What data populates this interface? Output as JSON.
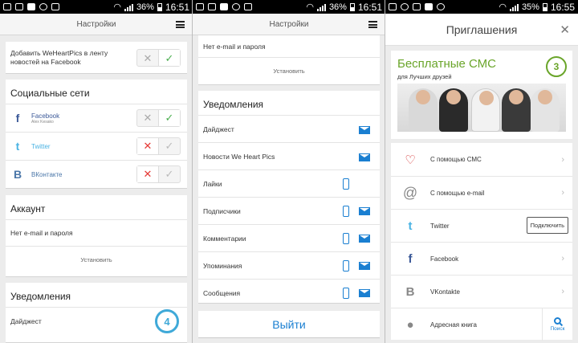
{
  "status_bar": [
    {
      "battery": "36%",
      "time": "16:51"
    },
    {
      "battery": "36%",
      "time": "16:51"
    },
    {
      "battery": "35%",
      "time": "16:55"
    }
  ],
  "screen1": {
    "title": "Настройки",
    "facebook_feed_label": "Добавить WeHeartPics в ленту новостей на Facebook",
    "social": {
      "title": "Социальные сети",
      "items": [
        {
          "name": "Facebook",
          "sub": "Alex Kesako",
          "connected": true
        },
        {
          "name": "Twitter",
          "connected": false
        },
        {
          "name": "ВКонтакте",
          "connected": false
        }
      ]
    },
    "account": {
      "title": "Аккаунт",
      "status": "Нет e-mail и пароля",
      "button": "Установить"
    },
    "notifications": {
      "title": "Уведомления",
      "first_item": "Дайджест",
      "step_badge": "4"
    }
  },
  "screen2": {
    "title": "Настройки",
    "account_status": "Нет e-mail и пароля",
    "account_button": "Установить",
    "notifications": {
      "title": "Уведомления",
      "items": [
        {
          "label": "Дайджест",
          "phone": false,
          "mail": true
        },
        {
          "label": "Новости We Heart Pics",
          "phone": false,
          "mail": true
        },
        {
          "label": "Лайки",
          "phone": true,
          "mail": false
        },
        {
          "label": "Подписчики",
          "phone": true,
          "mail": true
        },
        {
          "label": "Комментарии",
          "phone": true,
          "mail": true
        },
        {
          "label": "Упоминания",
          "phone": true,
          "mail": true
        },
        {
          "label": "Сообщения",
          "phone": true,
          "mail": true
        }
      ]
    },
    "logout": "Выйти"
  },
  "screen3": {
    "title": "Приглашения",
    "promo": {
      "title": "Бесплатные СМС",
      "subtitle": "для Лучших друзей",
      "step_badge": "3"
    },
    "items": [
      {
        "label": "С помощью СМС",
        "icon": "sms-heart-icon"
      },
      {
        "label": "С помощью e-mail",
        "icon": "at-icon"
      },
      {
        "label": "Twitter",
        "icon": "twitter-icon",
        "action": "Подключить"
      },
      {
        "label": "Facebook",
        "icon": "facebook-icon"
      },
      {
        "label": "VKontakte",
        "icon": "vkontakte-icon"
      },
      {
        "label": "Адресная книга",
        "icon": "person-icon",
        "action": "Поиск"
      }
    ]
  },
  "colors": {
    "accent_blue": "#1a7fd1",
    "badge_blue": "#3fa9d8",
    "promo_green": "#6aa52a",
    "toggle_on": "#4caf50",
    "toggle_off": "#e53935"
  }
}
